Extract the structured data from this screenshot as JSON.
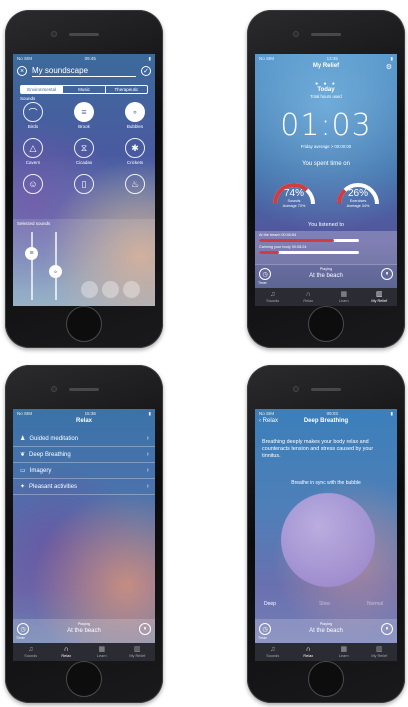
{
  "screen1": {
    "status": {
      "carrier": "No SIM",
      "time": "09:45"
    },
    "title": "My soundscape",
    "tabs": [
      "Environmental",
      "Music",
      "Therapeutic"
    ],
    "section_sounds": "Sounds",
    "sounds": [
      "Birds",
      "Brook",
      "Bubbles",
      "Cavern",
      "Cicadas",
      "Crickets",
      "",
      "",
      ""
    ],
    "section_selected": "Selected sounds",
    "colors": {
      "accent": "#3d6a98"
    }
  },
  "screen2": {
    "status": {
      "carrier": "No SIM",
      "time": "13:35"
    },
    "title": "My Relief",
    "today": "Today",
    "total_label": "Total hours used",
    "time_value": "01:03",
    "average": "Friday average > 00:00:00",
    "spent_title": "You spent time on",
    "gauge_sounds": {
      "value": "74%",
      "label1": "Sounds",
      "label2": "Average 70%",
      "fraction": 0.74
    },
    "gauge_exercises": {
      "value": "26%",
      "label1": "Exercises",
      "label2": "Average 34%",
      "fraction": 0.26
    },
    "listened_title": "You listened to",
    "tracks": [
      {
        "label": "At the beach 00:40:54",
        "fraction": 0.75
      },
      {
        "label": "Calming your body 00:08:24",
        "fraction": 0.2
      }
    ],
    "player": {
      "left": "Timer",
      "top": "Playing",
      "track": "At the beach"
    }
  },
  "screen3": {
    "status": {
      "carrier": "No SIM",
      "time": "15:36"
    },
    "title": "Relax",
    "items": [
      "Guided meditation",
      "Deep Breathing",
      "Imagery",
      "Pleasant activities"
    ],
    "player": {
      "left": "Timer",
      "top": "Playing",
      "track": "At the beach"
    }
  },
  "screen4": {
    "status": {
      "carrier": "No SIM",
      "time": "09:03"
    },
    "back": "Relax",
    "title": "Deep Breathing",
    "description": "Breathing deeply makes your body relax and counteracts tension and stress caused by your tinnitus.",
    "instruction": "Breathe in sync with the bubble",
    "speeds": [
      "Deep",
      "Slow",
      "Normal"
    ],
    "player": {
      "left": "Timer",
      "top": "Playing",
      "track": "At the beach"
    }
  },
  "tabbar": {
    "items": [
      "Sounds",
      "Relax",
      "Learn",
      "My Relief"
    ]
  }
}
